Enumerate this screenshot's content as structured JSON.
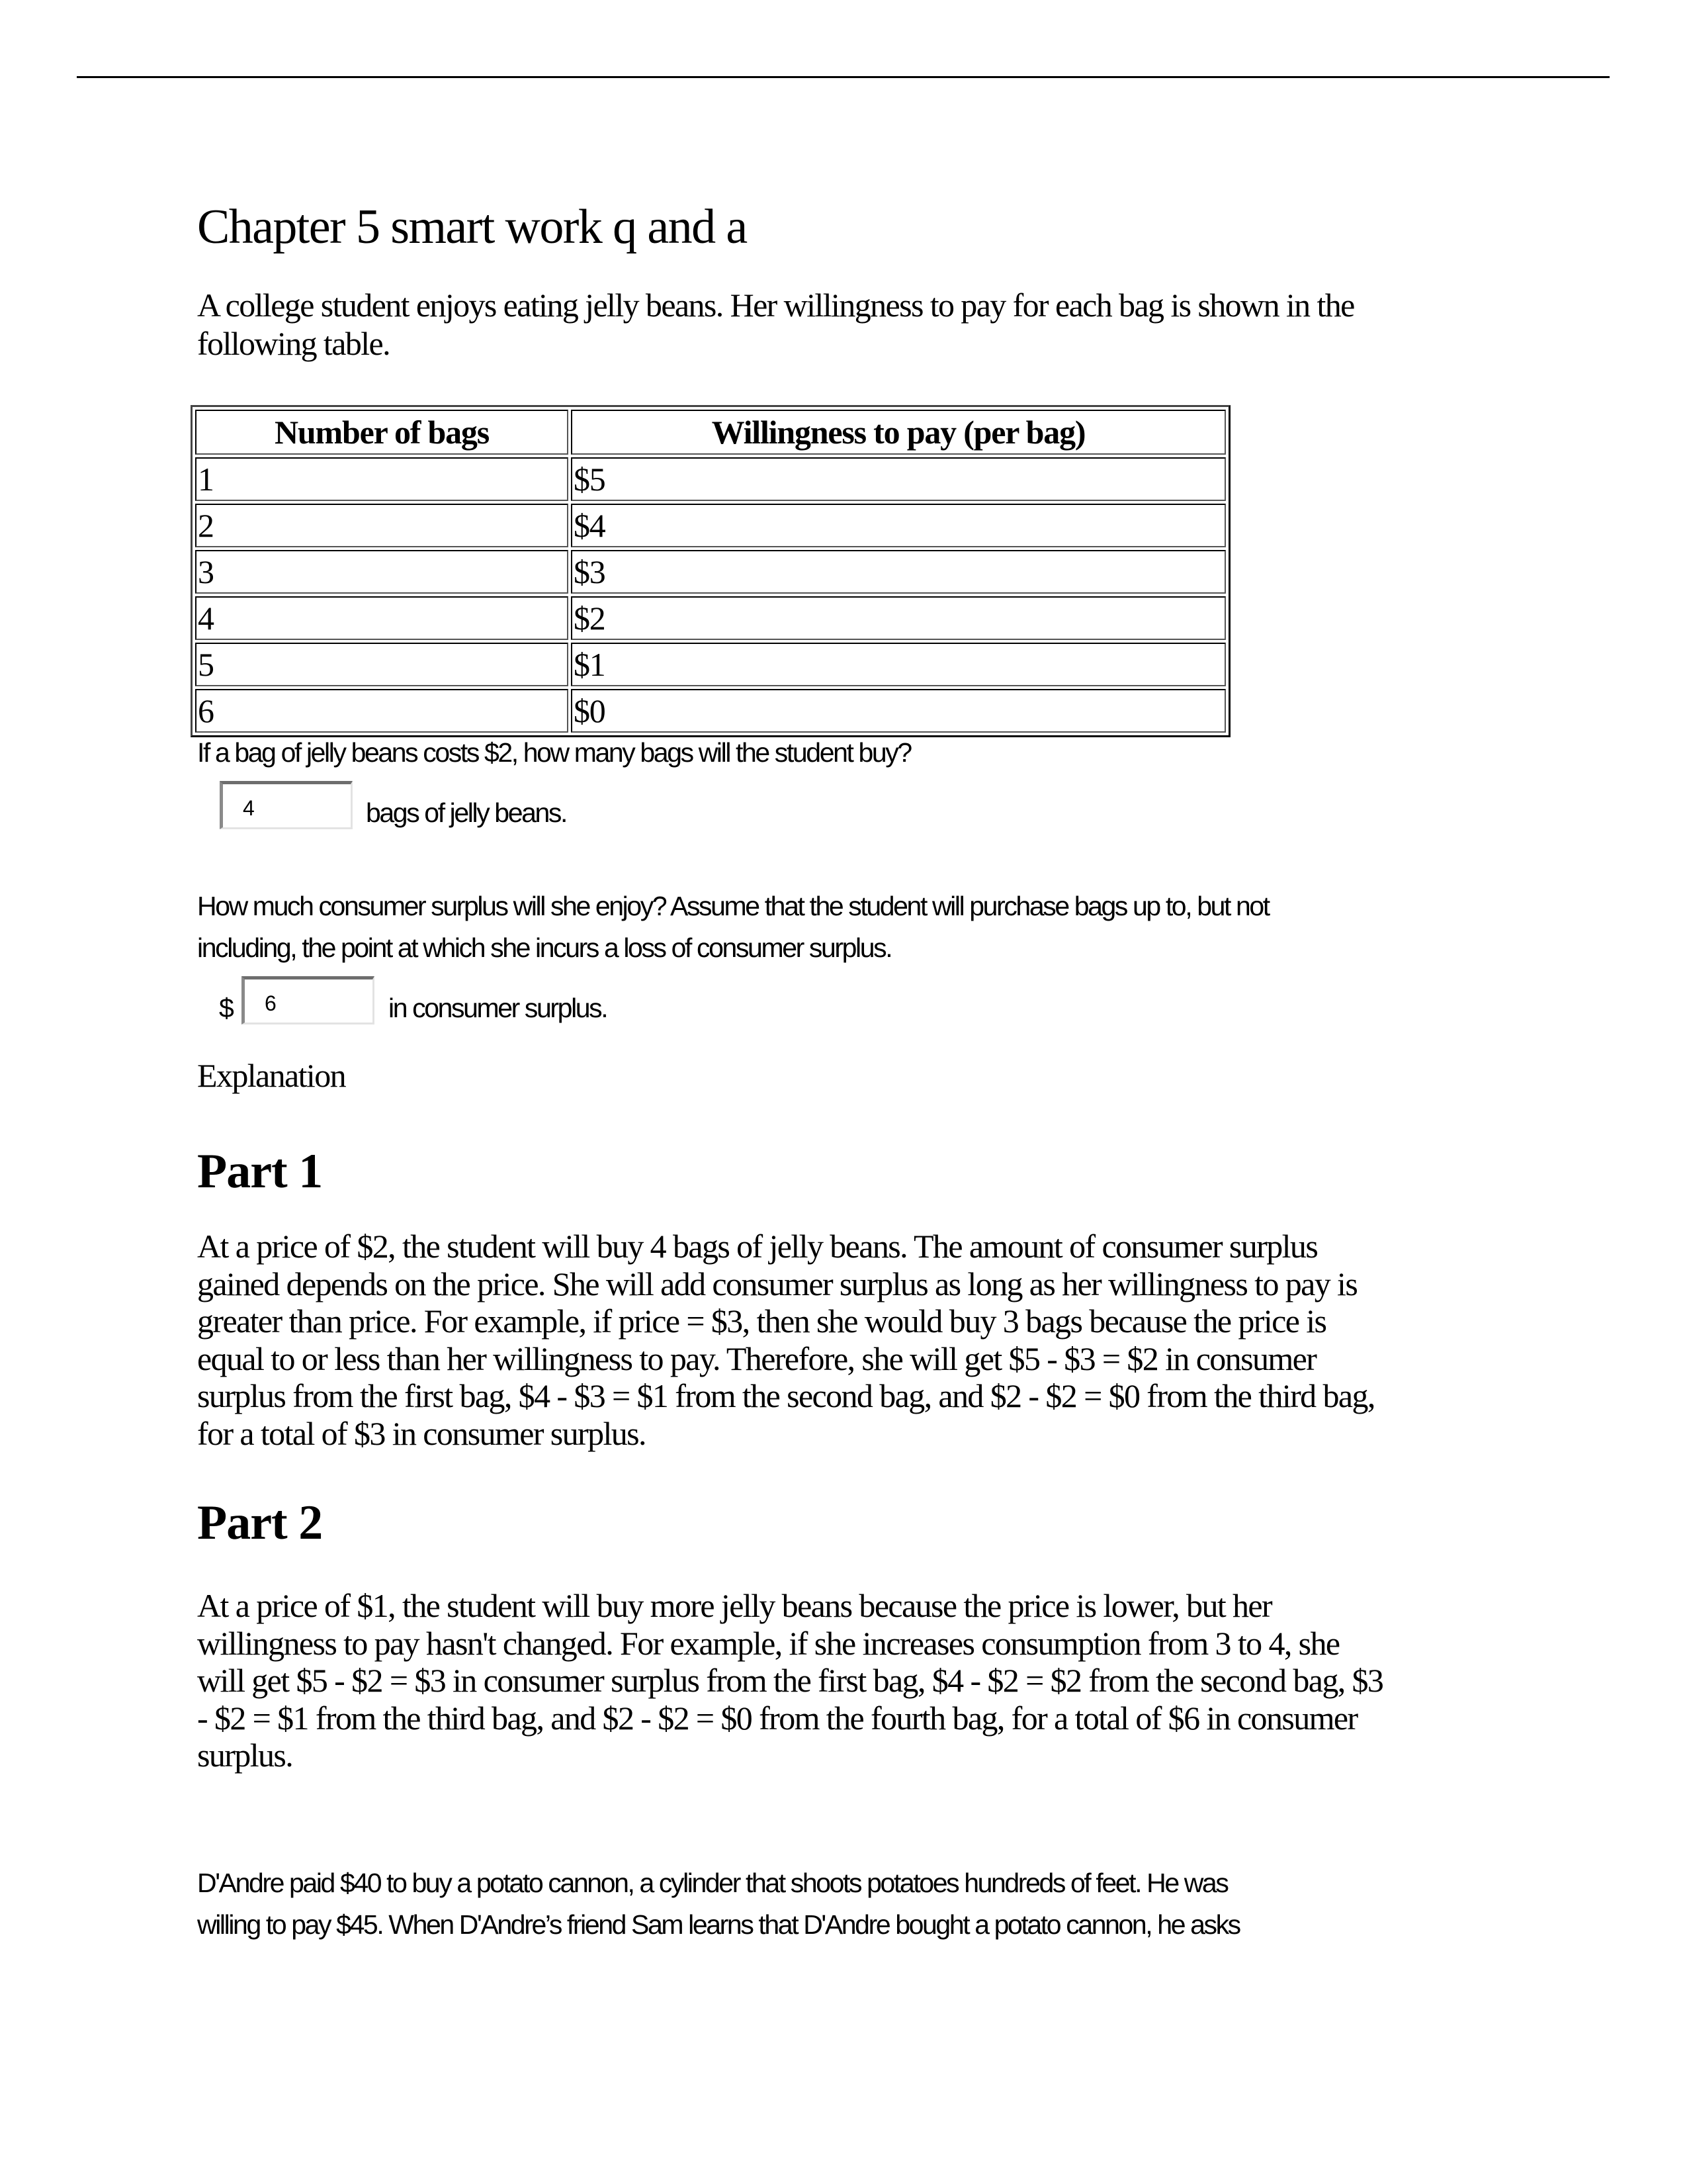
{
  "document": {
    "title": "Chapter 5 smart work q and a",
    "intro_lines": [
      "A college student enjoys eating jelly beans. Her willingness to pay for each bag is shown in the",
      "following table."
    ],
    "table": {
      "headers": [
        "Number of bags",
        "Willingness to pay (per bag)"
      ],
      "rows": [
        [
          "1",
          "$5"
        ],
        [
          "2",
          "$4"
        ],
        [
          "3",
          "$3"
        ],
        [
          "4",
          "$2"
        ],
        [
          "5",
          "$1"
        ],
        [
          "6",
          "$0"
        ]
      ]
    },
    "question1": {
      "text": "If a bag of jelly beans costs $2, how many bags will the student buy?",
      "answer_value": "4",
      "suffix": "bags of jelly beans."
    },
    "question2": {
      "lines": [
        "How much consumer surplus will she enjoy? Assume that the student will purchase bags up to, but not",
        "including, the point at which she incurs a loss of consumer surplus."
      ],
      "prefix": "$",
      "answer_value": "6",
      "suffix": "in consumer surplus."
    },
    "explanation_label": "Explanation",
    "parts": [
      {
        "heading": "Part 1",
        "lines": [
          "At a price of $2, the student will buy 4 bags of jelly beans. The amount of consumer surplus",
          "gained depends on the price. She will add consumer surplus as long as her willingness to pay is",
          "greater than price.  For example, if price = $3, then she would buy 3 bags because the price is",
          "equal to or less than her willingness to pay. Therefore, she will get $5 - $3 = $2 in consumer",
          "surplus from the first bag, $4 - $3 = $1 from the second bag, and $2 - $2 = $0 from the third bag,",
          "for a total of $3 in consumer surplus."
        ]
      },
      {
        "heading": "Part 2",
        "lines": [
          "At a price of $1, the student will buy more jelly beans because the price is lower, but her",
          "willingness to pay hasn't changed. For example, if she increases consumption from 3 to 4, she",
          "will get $5 - $2 = $3 in consumer surplus from the first bag, $4 - $2 = $2 from the second bag, $3",
          "- $2 = $1 from the third bag, and $2 - $2 = $0 from the fourth bag, for a total of $6 in consumer",
          "surplus."
        ]
      }
    ],
    "next_question_lines": [
      "D'Andre paid $40 to buy a potato cannon, a cylinder that shoots potatoes hundreds of feet. He was",
      "willing to pay $45. When D'Andre’s friend Sam learns that D'Andre bought a potato cannon, he asks"
    ]
  }
}
